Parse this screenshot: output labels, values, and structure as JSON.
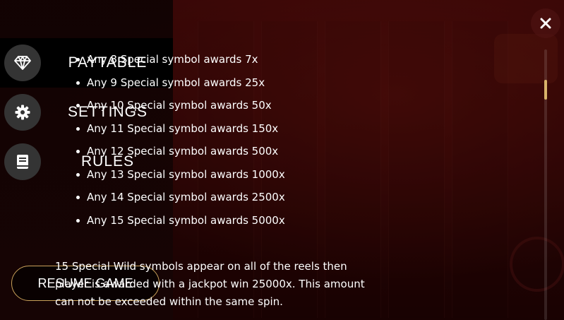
{
  "colors": {
    "sidebar_bg": "#0c0202",
    "active_item_bg": "#000000",
    "icon_circle": "#343434",
    "resume_border": "#c9a15a",
    "scroll_thumb": "#d9b36a",
    "text": "#ffffff"
  },
  "sidebar": {
    "items": [
      {
        "label": "PAYTABLE",
        "icon": "diamond-icon",
        "active": true
      },
      {
        "label": "SETTINGS",
        "icon": "gear-icon",
        "active": false
      },
      {
        "label": "RULES",
        "icon": "book-icon",
        "active": false
      }
    ],
    "resume_label": "RESUME GAME"
  },
  "paytable": {
    "awards": [
      "Any 8 Special symbol awards 7x",
      "Any 9 Special symbol awards 25x",
      "Any 10 Special symbol awards 50x",
      "Any 11 Special symbol awards 150x",
      "Any 12 Special symbol awards 500x",
      "Any 13 Special symbol awards 1000x",
      "Any 14 Special symbol awards 2500x",
      "Any 15 Special symbol awards 5000x"
    ],
    "paragraph": "15 Special Wild symbols appear on all of the reels then player is awarded with a jackpot win 25000x. This amount can not be exceeded within the same spin."
  },
  "close_icon": "close-icon"
}
